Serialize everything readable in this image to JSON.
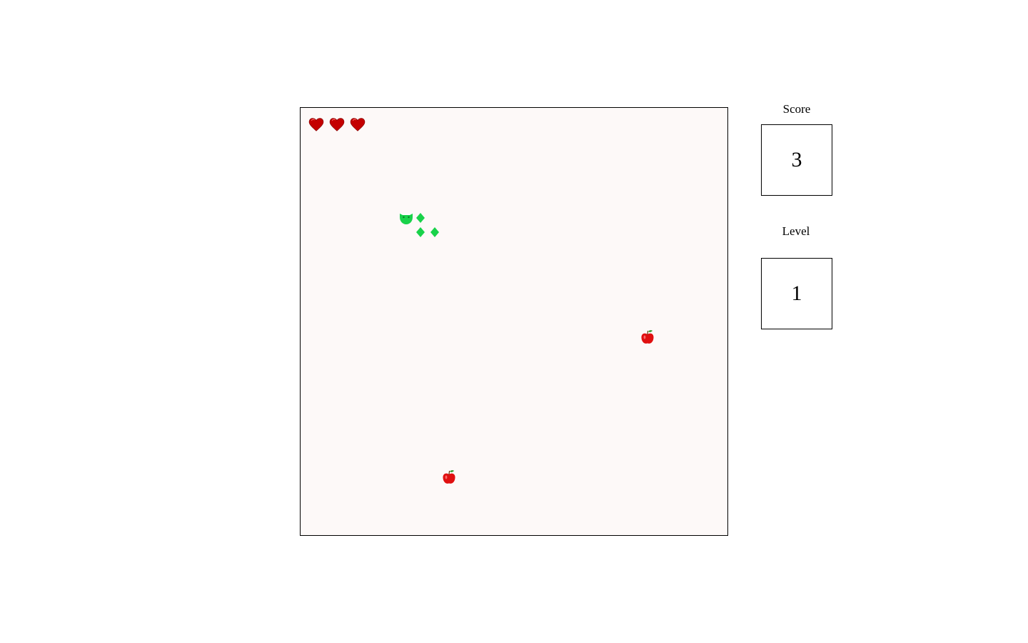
{
  "game": {
    "lives": 3,
    "colors": {
      "board_background": "#fdf9f8",
      "snake": "#19d24a",
      "heart": "#c40000",
      "apple": "#e01010"
    },
    "icons": {
      "life": "heart-icon",
      "food": "apple-icon",
      "snake_head": "snake-head-icon",
      "snake_body": "diamond-segment-icon"
    }
  },
  "sidebar": {
    "score_label": "Score",
    "score_value": "3",
    "level_label": "Level",
    "level_value": "1"
  }
}
